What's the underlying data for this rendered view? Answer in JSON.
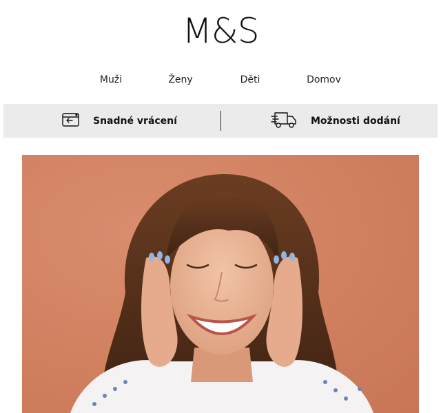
{
  "brand": {
    "logo_text": "M&S"
  },
  "nav": {
    "items": [
      {
        "label": "Muži"
      },
      {
        "label": "Ženy"
      },
      {
        "label": "Děti"
      },
      {
        "label": "Domov"
      }
    ]
  },
  "service_bar": {
    "returns": {
      "label": "Snadné vrácení",
      "icon": "return-card-icon"
    },
    "delivery": {
      "label": "Možnosti dodání",
      "icon": "delivery-truck-icon"
    }
  },
  "hero": {
    "image": "smiling-woman-hands-on-cheeks",
    "background_color": "#d0805f"
  }
}
